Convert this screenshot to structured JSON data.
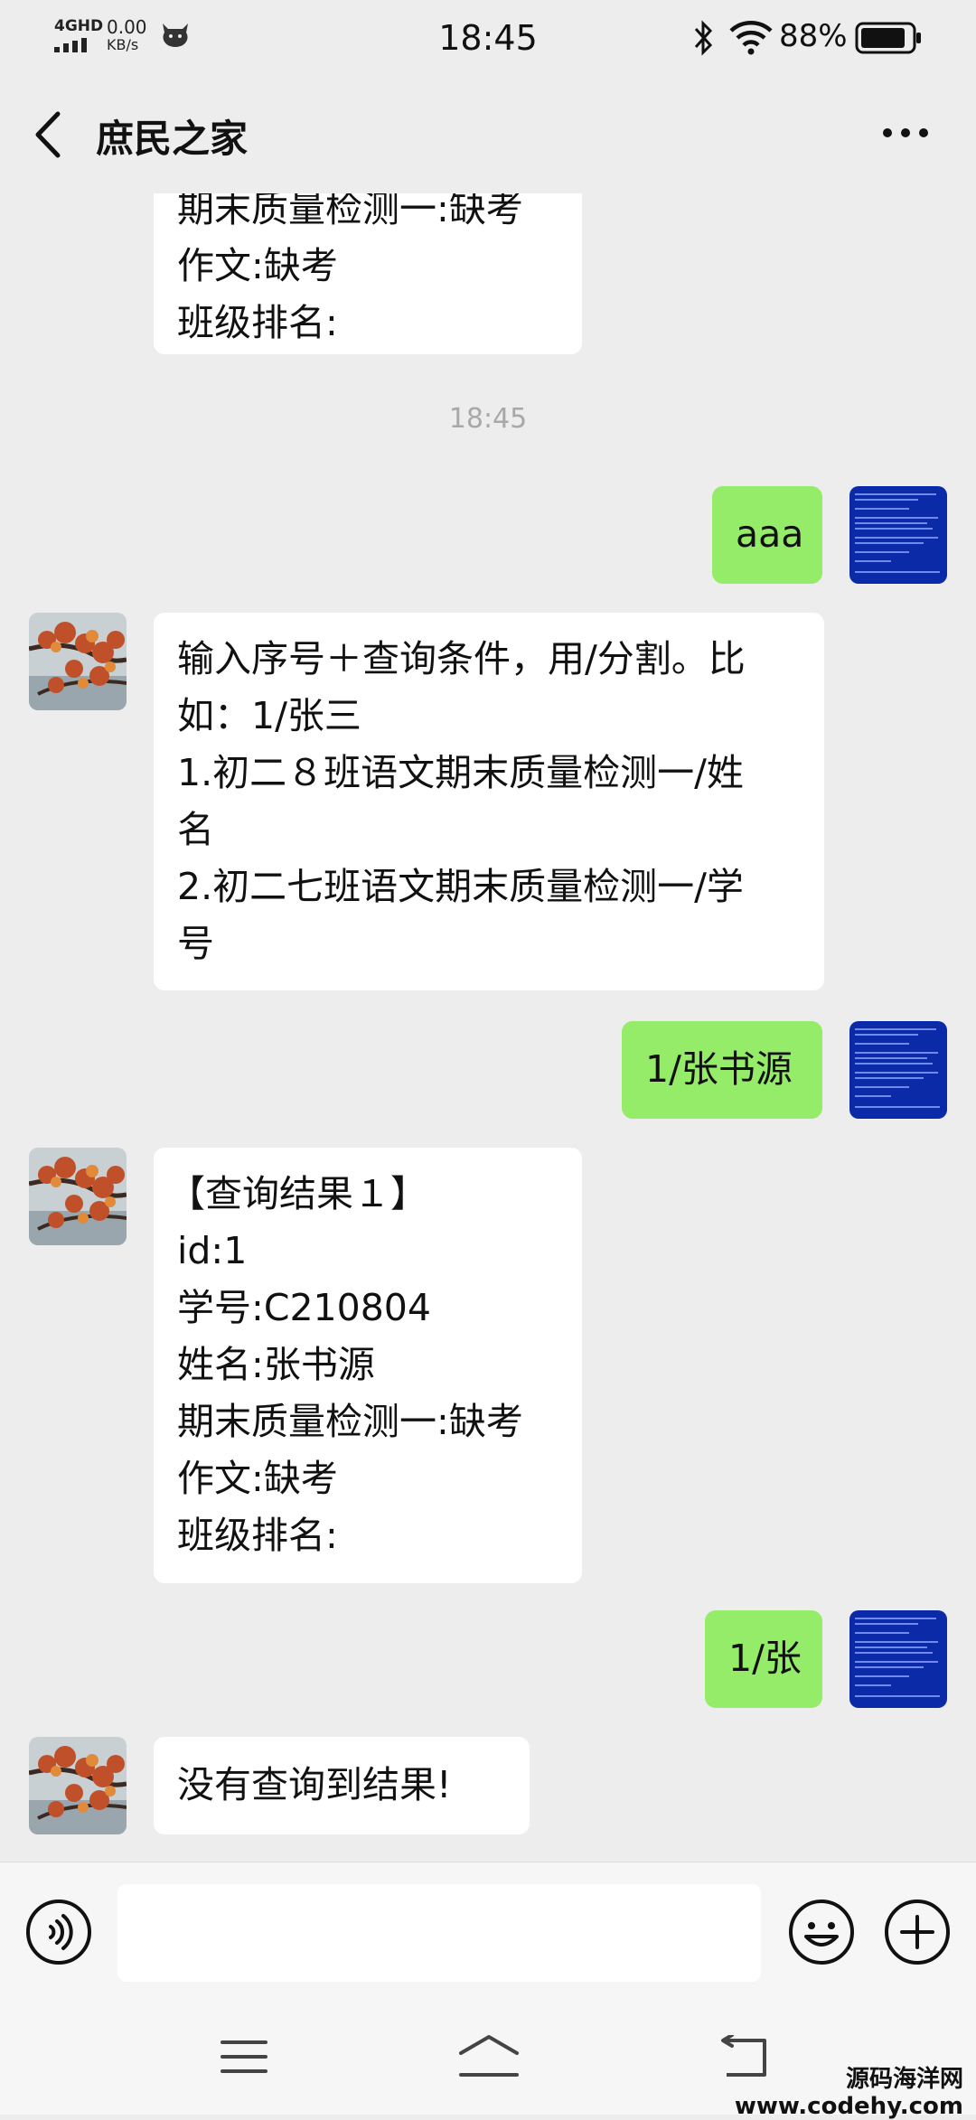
{
  "status_bar": {
    "network": "4GHD",
    "speed_value": "0.00",
    "speed_unit": "KB/s",
    "time": "18:45",
    "battery_percent": "88%",
    "battery_level": 0.88
  },
  "nav": {
    "title": "庶民之家"
  },
  "chat": {
    "top_partial_lines": [
      "期末质量检测一:缺考",
      "作文:缺考",
      "班级排名:"
    ],
    "timestamp": "18:45",
    "messages": [
      {
        "side": "out",
        "lines": [
          "aaa"
        ]
      },
      {
        "side": "in",
        "lines": [
          "输入序号＋查询条件，用/分割。比",
          "如：1/张三",
          "1.初二８班语文期末质量检测一/姓",
          "名",
          "2.初二七班语文期末质量检测一/学",
          "号"
        ]
      },
      {
        "side": "out",
        "lines": [
          "1/张书源"
        ]
      },
      {
        "side": "in",
        "lines": [
          "【查询结果１】",
          "id:1",
          "学号:C210804",
          "姓名:张书源",
          "期末质量检测一:缺考",
          "作文:缺考",
          "班级排名:"
        ]
      },
      {
        "side": "out",
        "lines": [
          "1/张"
        ]
      },
      {
        "side": "in",
        "lines": [
          "没有查询到结果!"
        ]
      }
    ]
  },
  "input": {
    "value": ""
  },
  "watermark": {
    "line1": "源码海洋网",
    "line2": "www.codehy.com"
  },
  "colors": {
    "background": "#ededed",
    "outgoing_bubble": "#95ec69",
    "incoming_bubble": "#ffffff",
    "timestamp": "#a8a8a8"
  },
  "icons": [
    "back-arrow-icon",
    "more-icon",
    "voice-icon",
    "emoji-icon",
    "plus-icon",
    "bluetooth-icon",
    "wifi-icon",
    "battery-icon",
    "signal-icon",
    "menu-icon",
    "home-icon",
    "return-icon"
  ]
}
